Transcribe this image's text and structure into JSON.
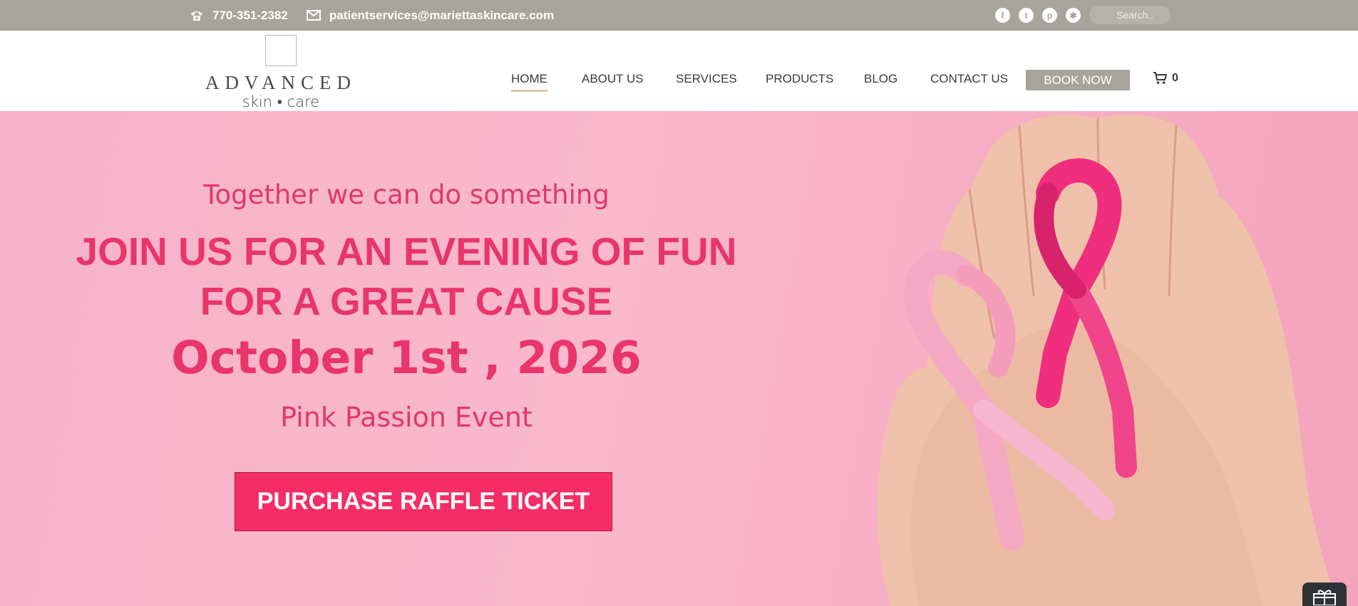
{
  "topbar": {
    "phone": "770-351-2382",
    "email": "patientservices@mariettaskincare.com",
    "social": [
      {
        "icon": "facebook-icon",
        "glyph": "f"
      },
      {
        "icon": "twitter-icon",
        "glyph": "t"
      },
      {
        "icon": "pinterest-icon",
        "glyph": "p"
      },
      {
        "icon": "yelp-icon",
        "glyph": "✱"
      }
    ],
    "search_placeholder": "Search.."
  },
  "logo": {
    "line1": "ADVANCED",
    "line2": "skin • care"
  },
  "nav": {
    "items": [
      "HOME",
      "ABOUT US",
      "SERVICES",
      "PRODUCTS",
      "BLOG",
      "CONTACT US"
    ],
    "active": "HOME",
    "book_label": "BOOK NOW",
    "cart_count": "0"
  },
  "hero": {
    "tagline": "Together we can do something",
    "headline_line1": "JOIN US FOR AN EVENING OF FUN",
    "headline_line2": "FOR A GREAT CAUSE",
    "date": "October 1st , 2026",
    "event": "Pink Passion Event",
    "cta": "PURCHASE RAFFLE TICKET"
  },
  "colors": {
    "topbar": "#a6a49c",
    "hero_text": "#e8356a",
    "cta_bg": "#f42d66",
    "hero_bg": "#f9b8cc"
  }
}
